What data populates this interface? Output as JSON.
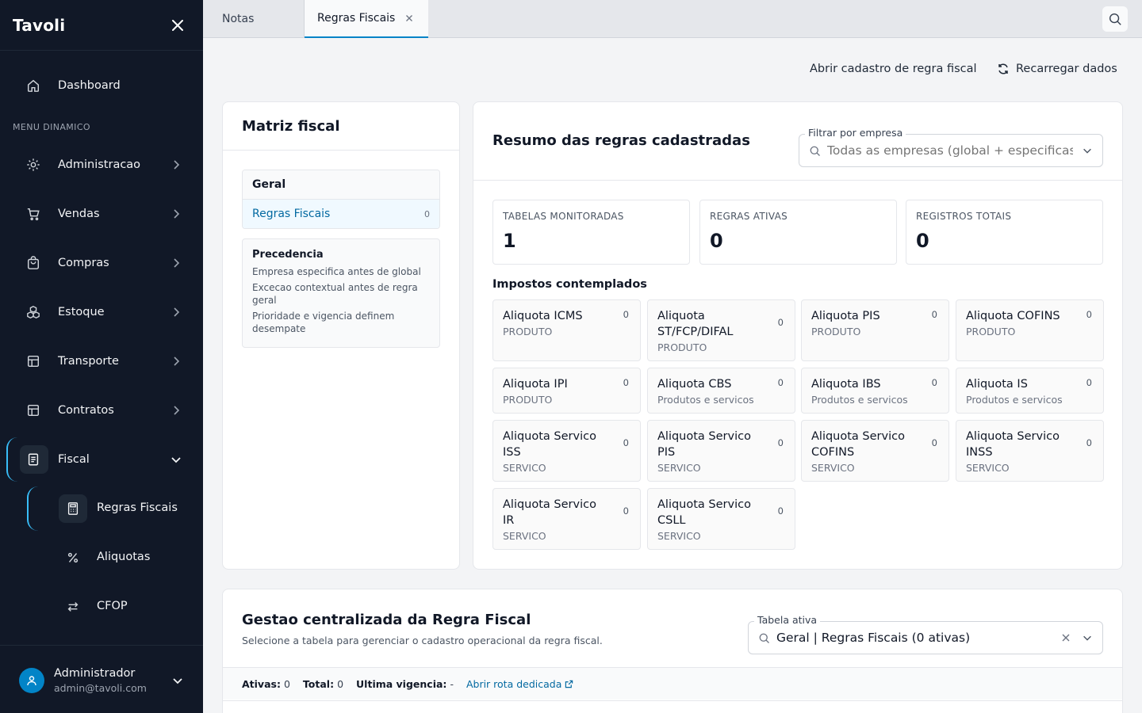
{
  "app": {
    "brand": "Tavoli"
  },
  "sidebar": {
    "section_label": "MENU DINAMICO",
    "items": [
      {
        "label": "Dashboard"
      },
      {
        "label": "Administracao"
      },
      {
        "label": "Vendas"
      },
      {
        "label": "Compras"
      },
      {
        "label": "Estoque"
      },
      {
        "label": "Transporte"
      },
      {
        "label": "Contratos"
      },
      {
        "label": "Fiscal"
      }
    ],
    "subitems": [
      {
        "label": "Regras Fiscais"
      },
      {
        "label": "Aliquotas"
      },
      {
        "label": "CFOP"
      }
    ],
    "user": {
      "name": "Administrador",
      "email": "admin@tavoli.com"
    }
  },
  "tabs": [
    {
      "label": "Notas"
    },
    {
      "label": "Regras Fiscais"
    }
  ],
  "actions": {
    "open_register": "Abrir cadastro de regra fiscal",
    "reload": "Recarregar dados"
  },
  "matrix": {
    "title": "Matriz fiscal",
    "group_title": "Geral",
    "group_item": {
      "label": "Regras Fiscais",
      "count": "0"
    },
    "precedence": {
      "title": "Precedencia",
      "lines": [
        "Empresa especifica antes de global",
        "Excecao contextual antes de regra geral",
        "Prioridade e vigencia definem desempate"
      ]
    }
  },
  "summary": {
    "title": "Resumo das regras cadastradas",
    "filter": {
      "label": "Filtrar por empresa",
      "placeholder": "Todas as empresas (global + especificas)"
    },
    "stats": [
      {
        "label": "TABELAS MONITORADAS",
        "value": "1"
      },
      {
        "label": "REGRAS ATIVAS",
        "value": "0"
      },
      {
        "label": "REGISTROS TOTAIS",
        "value": "0"
      }
    ],
    "taxes_title": "Impostos contemplados",
    "taxes": [
      {
        "name": "Aliquota ICMS",
        "sub": "PRODUTO",
        "count": "0"
      },
      {
        "name": "Aliquota ST/FCP/DIFAL",
        "sub": "PRODUTO",
        "count": "0"
      },
      {
        "name": "Aliquota PIS",
        "sub": "PRODUTO",
        "count": "0"
      },
      {
        "name": "Aliquota COFINS",
        "sub": "PRODUTO",
        "count": "0"
      },
      {
        "name": "Aliquota IPI",
        "sub": "PRODUTO",
        "count": "0"
      },
      {
        "name": "Aliquota CBS",
        "sub": "Produtos e servicos",
        "count": "0"
      },
      {
        "name": "Aliquota IBS",
        "sub": "Produtos e servicos",
        "count": "0"
      },
      {
        "name": "Aliquota IS",
        "sub": "Produtos e servicos",
        "count": "0"
      },
      {
        "name": "Aliquota Servico ISS",
        "sub": "SERVICO",
        "count": "0"
      },
      {
        "name": "Aliquota Servico PIS",
        "sub": "SERVICO",
        "count": "0"
      },
      {
        "name": "Aliquota Servico COFINS",
        "sub": "SERVICO",
        "count": "0"
      },
      {
        "name": "Aliquota Servico INSS",
        "sub": "SERVICO",
        "count": "0"
      },
      {
        "name": "Aliquota Servico IR",
        "sub": "SERVICO",
        "count": "0"
      },
      {
        "name": "Aliquota Servico CSLL",
        "sub": "SERVICO",
        "count": "0"
      }
    ]
  },
  "management": {
    "title": "Gestao centralizada da Regra Fiscal",
    "subtitle": "Selecione a tabela para gerenciar o cadastro operacional da regra fiscal.",
    "table_label": "Tabela ativa",
    "table_value": "Geral | Regras Fiscais (0 ativas)",
    "meta": {
      "active_label": "Ativas:",
      "active_value": "0",
      "total_label": "Total:",
      "total_value": "0",
      "validity_label": "Ultima vigencia:",
      "validity_value": "-",
      "dedicated_link": "Abrir rota dedicada"
    }
  },
  "colors": {
    "sidebar_bg": "#111827",
    "accent": "#0284c7",
    "accent_light": "#38bdf8"
  }
}
